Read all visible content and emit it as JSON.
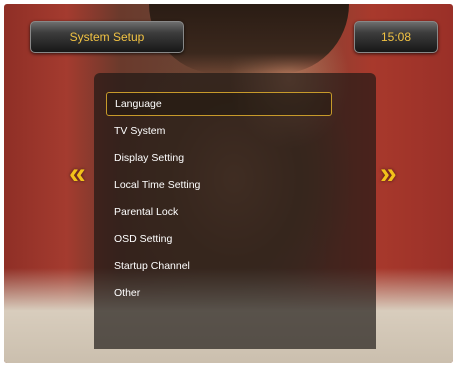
{
  "header": {
    "title": "System Setup",
    "clock": "15:08"
  },
  "menu": {
    "items": [
      {
        "label": "Language",
        "selected": true
      },
      {
        "label": "TV System",
        "selected": false
      },
      {
        "label": "Display Setting",
        "selected": false
      },
      {
        "label": "Local Time Setting",
        "selected": false
      },
      {
        "label": "Parental Lock",
        "selected": false
      },
      {
        "label": "OSD Setting",
        "selected": false
      },
      {
        "label": "Startup Channel",
        "selected": false
      },
      {
        "label": "Other",
        "selected": false
      }
    ]
  },
  "navigation": {
    "left_arrow": "«",
    "right_arrow": "»"
  },
  "colors": {
    "accent": "#f1c243",
    "selection_border": "#c79a2a",
    "arrow": "#f2c21a"
  },
  "icons": {
    "prev_page": "double-chevron-left-icon",
    "next_page": "double-chevron-right-icon"
  }
}
